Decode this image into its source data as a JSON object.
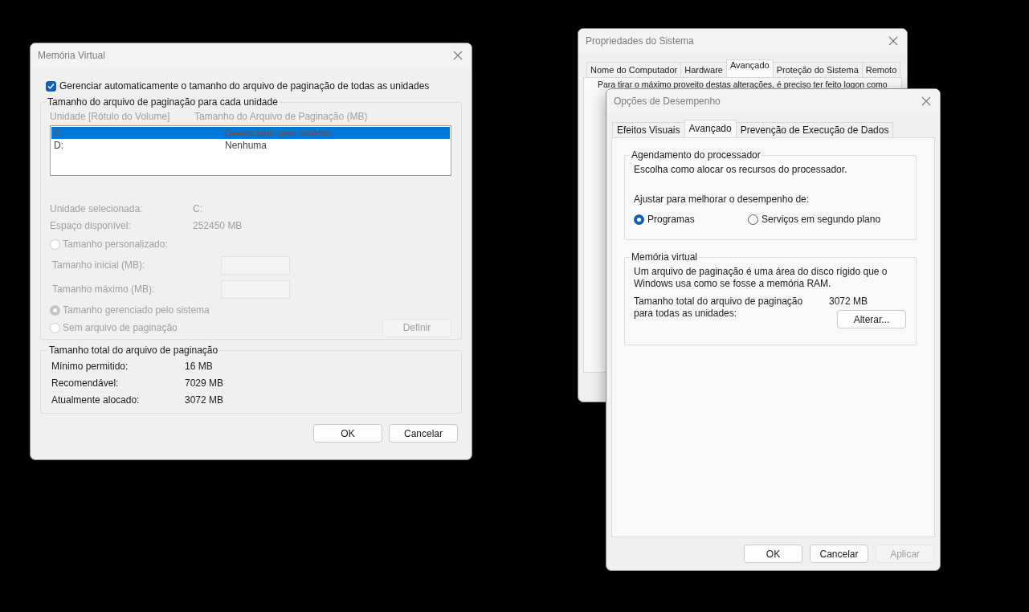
{
  "virtual_memory_dialog": {
    "title": "Memória Virtual",
    "auto_manage": {
      "label": "Gerenciar automaticamente o tamanho do arquivo de paginação de todas as unidades",
      "checked": true
    },
    "drives_group": {
      "title": "Tamanho do arquivo de paginação para cada unidade",
      "columns": [
        "Unidade [Rótulo do Volume]",
        "Tamanho do Arquivo de Paginação (MB)"
      ],
      "rows": [
        {
          "drive": "C:",
          "size": "Gerenciado pelo sistema",
          "selected": true
        },
        {
          "drive": "D:",
          "size": "Nenhuma",
          "selected": false
        }
      ],
      "info": [
        {
          "label": "Unidade selecionada:",
          "value": "C:"
        },
        {
          "label": "Espaço disponível:",
          "value": "252450 MB"
        }
      ],
      "custom_option": {
        "label": "Tamanho personalizado:",
        "selected": false
      },
      "fields": [
        {
          "label": "Tamanho inicial (MB):"
        },
        {
          "label": "Tamanho máximo (MB):"
        }
      ],
      "other_options": [
        {
          "label": "Tamanho gerenciado pelo sistema",
          "selected": true
        },
        {
          "label": "Sem arquivo de paginação",
          "selected": false
        }
      ],
      "set_button": "Definir"
    },
    "totals_group": {
      "title": "Tamanho total do arquivo de paginação",
      "rows": [
        {
          "label": "Mínimo permitido:",
          "value": "16 MB"
        },
        {
          "label": "Recomendável:",
          "value": "7029 MB"
        },
        {
          "label": "Atualmente alocado:",
          "value": "3072 MB"
        }
      ]
    },
    "buttons": [
      {
        "label": "OK",
        "disabled": false
      },
      {
        "label": "Cancelar",
        "disabled": false
      }
    ]
  },
  "system_properties": {
    "title": "Propriedades do Sistema",
    "tabs": [
      {
        "label": "Nome do Computador",
        "selected": false
      },
      {
        "label": "Hardware",
        "selected": false
      },
      {
        "label": "Avançado",
        "selected": true
      },
      {
        "label": "Proteção do Sistema",
        "selected": false
      },
      {
        "label": "Remoto",
        "selected": false
      }
    ],
    "intro": "Para tirar o máximo proveito destas alterações, é preciso ter feito logon como"
  },
  "performance_options": {
    "title": "Opções de Desempenho",
    "tabs": [
      {
        "label": "Efeitos Visuais",
        "selected": false
      },
      {
        "label": "Avançado",
        "selected": true
      },
      {
        "label": "Prevenção de Execução de Dados",
        "selected": false
      }
    ],
    "scheduling": {
      "title": "Agendamento do processador",
      "description": "Escolha como alocar os recursos do processador.",
      "prompt": "Ajustar para melhorar o desempenho de:",
      "options": [
        {
          "label": "Programas",
          "selected": true
        },
        {
          "label": "Serviços em segundo plano",
          "selected": false
        }
      ]
    },
    "virtual_memory": {
      "title": "Memória virtual",
      "description": "Um arquivo de paginação é uma área do disco rígido que o Windows usa como se fosse a memória RAM.",
      "total_label": "Tamanho total do arquivo de paginação para todas as unidades:",
      "total_value": "3072 MB",
      "change_button": "Alterar..."
    },
    "buttons": [
      {
        "label": "OK",
        "disabled": false
      },
      {
        "label": "Cancelar",
        "disabled": false
      },
      {
        "label": "Aplicar",
        "disabled": true
      }
    ]
  }
}
